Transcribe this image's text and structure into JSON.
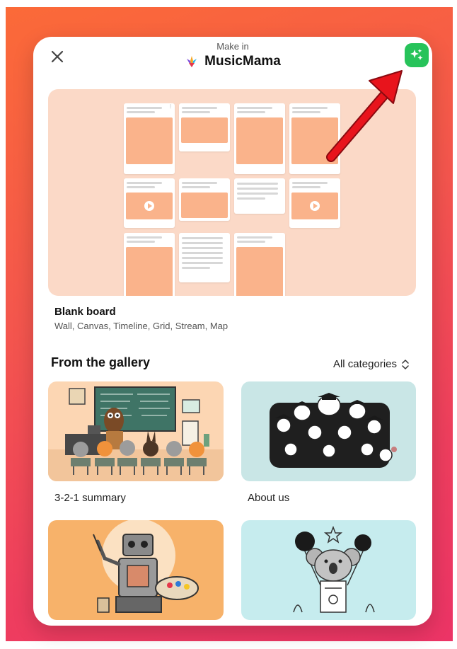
{
  "modal": {
    "make_in": "Make in",
    "brand": "MusicMama"
  },
  "blank_board": {
    "title": "Blank board",
    "formats": "Wall, Canvas, Timeline, Grid, Stream, Map"
  },
  "gallery": {
    "heading": "From the gallery",
    "category_select": "All categories",
    "items": [
      {
        "label": "3-2-1 summary"
      },
      {
        "label": "About us"
      },
      {
        "label": ""
      },
      {
        "label": ""
      }
    ]
  },
  "colors": {
    "background_gradient_top": "#fb6a38",
    "background_gradient_bottom": "#ec3466",
    "ai_button": "#27c35a",
    "annotation_arrow": "#e8141c",
    "preview_bg": "#fbd9c7",
    "card_image": "#fab38b",
    "tile_1": "#fcd6b3",
    "tile_2": "#c9e6e6",
    "tile_3": "#f7b26a",
    "tile_4": "#c6ecee"
  }
}
